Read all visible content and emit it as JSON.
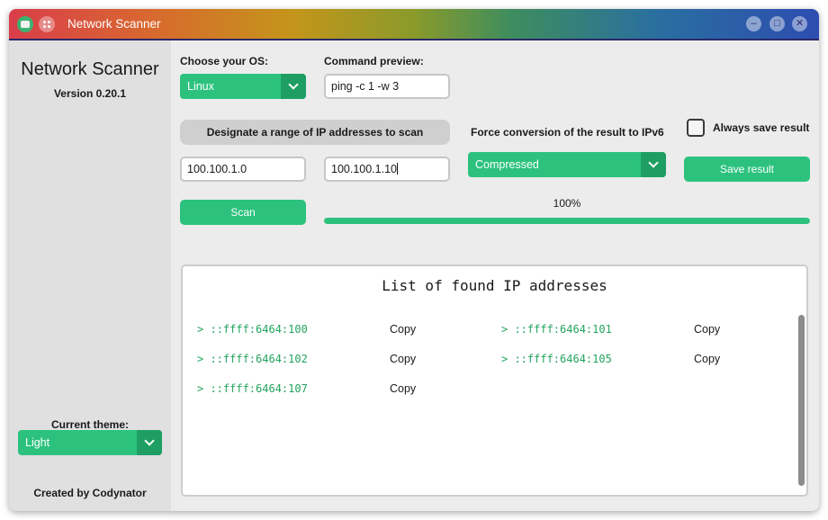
{
  "window": {
    "title": "Network Scanner"
  },
  "sidebar": {
    "app_name": "Network Scanner",
    "version": "Version 0.20.1",
    "theme_label": "Current theme:",
    "theme_value": "Light",
    "credit": "Created by Codynator"
  },
  "os": {
    "label": "Choose your OS:",
    "value": "Linux"
  },
  "command": {
    "label": "Command preview:",
    "value": "ping -c 1 -w 3"
  },
  "range": {
    "button_label": "Designate a range of IP addresses to scan",
    "start": "100.100.1.0",
    "end": "100.100.1.10"
  },
  "conversion": {
    "label": "Force conversion of the result to IPv6",
    "value": "Compressed"
  },
  "always_save": {
    "label": "Always save result",
    "checked": false
  },
  "save_button": "Save result",
  "scan_button": "Scan",
  "progress": {
    "text": "100%",
    "value": 1.0
  },
  "results": {
    "title": "List of found IP addresses",
    "copy_label": "Copy",
    "items": [
      "> ::ffff:6464:100",
      "> ::ffff:6464:101",
      "> ::ffff:6464:102",
      "> ::ffff:6464:105",
      "> ::ffff:6464:107"
    ]
  },
  "colors": {
    "accent": "#2cc27e",
    "accent_dark": "#1e9e63",
    "ip_text": "#23a35e",
    "sidebar_bg": "#e0e0e0",
    "main_bg": "#ececec"
  },
  "icons": {
    "app": "network-app-icon",
    "menu": "menu-dots-icon",
    "minimize": "minimize-icon",
    "maximize": "maximize-icon",
    "close": "close-icon",
    "dropdown": "chevron-down-icon"
  }
}
